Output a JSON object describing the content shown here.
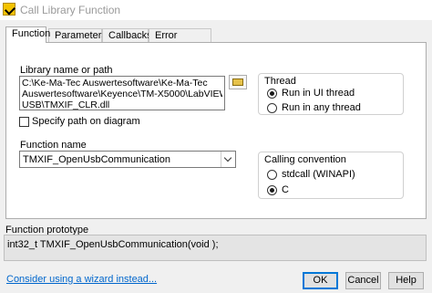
{
  "window": {
    "title": "Call Library Function"
  },
  "tabs": [
    {
      "label": "Function",
      "active": true
    },
    {
      "label": "Parameters",
      "active": false
    },
    {
      "label": "Callbacks",
      "active": false
    },
    {
      "label": "Error Checking",
      "active": false
    }
  ],
  "function_tab": {
    "library_label": "Library name or path",
    "library_path_lines": [
      "C:\\Ke-Ma-Tec Auswertesoftware\\Ke-Ma-Tec",
      "Auswertesoftware\\Keyence\\TM-X5000\\LabVIEW\\Open",
      "USB\\TMXIF_CLR.dll"
    ],
    "browse_icon": "folder-open-icon",
    "specify_path_label": "Specify path on diagram",
    "specify_path_checked": false,
    "function_name_label": "Function name",
    "function_name_value": "TMXIF_OpenUsbCommunication",
    "thread": {
      "title": "Thread",
      "options": [
        "Run in UI thread",
        "Run in any thread"
      ],
      "selected": "Run in UI thread"
    },
    "calling_convention": {
      "title": "Calling convention",
      "options": [
        "stdcall (WINAPI)",
        "C"
      ],
      "selected": "C"
    }
  },
  "prototype": {
    "label": "Function prototype",
    "text": "int32_t TMXIF_OpenUsbCommunication(void );"
  },
  "footer": {
    "wizard_link": "Consider using a wizard instead...",
    "ok_label": "OK",
    "cancel_label": "Cancel",
    "help_label": "Help"
  },
  "colors": {
    "link": "#0066cc",
    "accent": "#0078d7",
    "app_icon": "#f3c300"
  }
}
